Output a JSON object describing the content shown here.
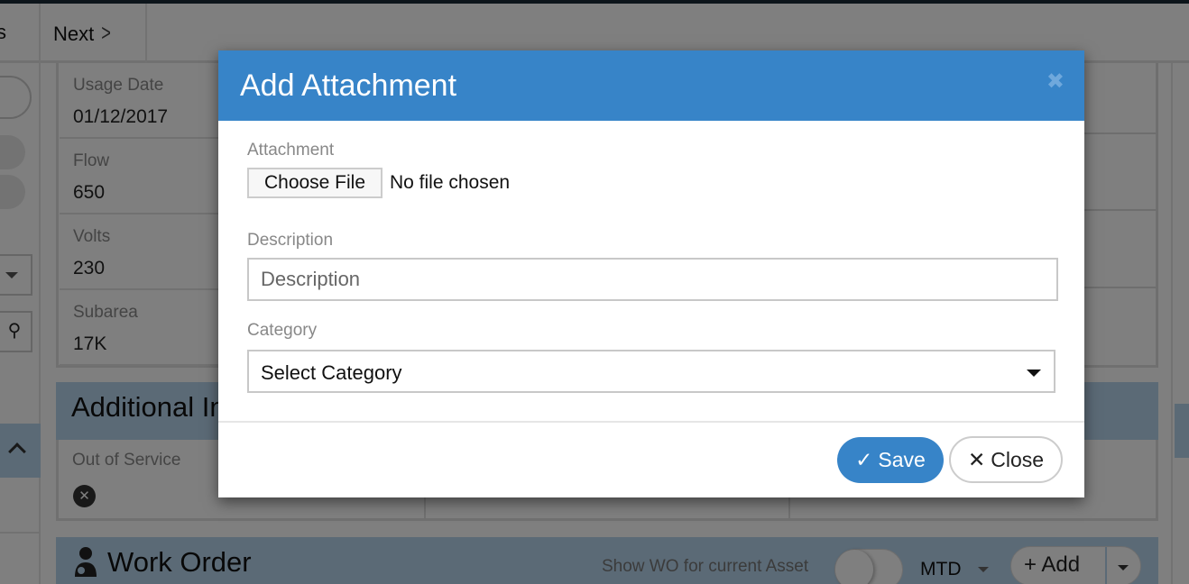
{
  "nav": {
    "prev_label_fragment": "s",
    "next_label": "Next",
    "next_icon": "chevron-right-icon"
  },
  "asset_fields": [
    {
      "label": "Usage Date",
      "value": "01/12/2017"
    },
    {
      "label": "Flow",
      "value": "650"
    },
    {
      "label": "Volts",
      "value": "230"
    },
    {
      "label": "Subarea",
      "value": "17K"
    }
  ],
  "additional_info": {
    "title": "Additional Information",
    "title_visible_fragment": "Additional In",
    "out_of_service_label": "Out of Service",
    "out_of_service_icon": "x-circle-icon"
  },
  "work_order": {
    "title": "Work Order",
    "icon": "worker-icon",
    "show_wo_label": "Show WO for current Asset",
    "period_select": "MTD",
    "add_label": "+ Add"
  },
  "modal": {
    "title": "Add Attachment",
    "close_icon": "close-icon",
    "attachment_label": "Attachment",
    "choose_file_label": "Choose File",
    "file_status": "No file chosen",
    "description_label": "Description",
    "description_placeholder": "Description",
    "description_value": "",
    "category_label": "Category",
    "category_selected": "Select Category",
    "save_label": "Save",
    "save_icon": "check-icon",
    "close_label": "Close",
    "close_btn_icon": "x-icon"
  },
  "colors": {
    "modal_header": "#3784c8",
    "primary_button": "#3784c8",
    "section_header": "#b6d4ec",
    "backdrop": "rgba(0,0,0,0.5)"
  }
}
